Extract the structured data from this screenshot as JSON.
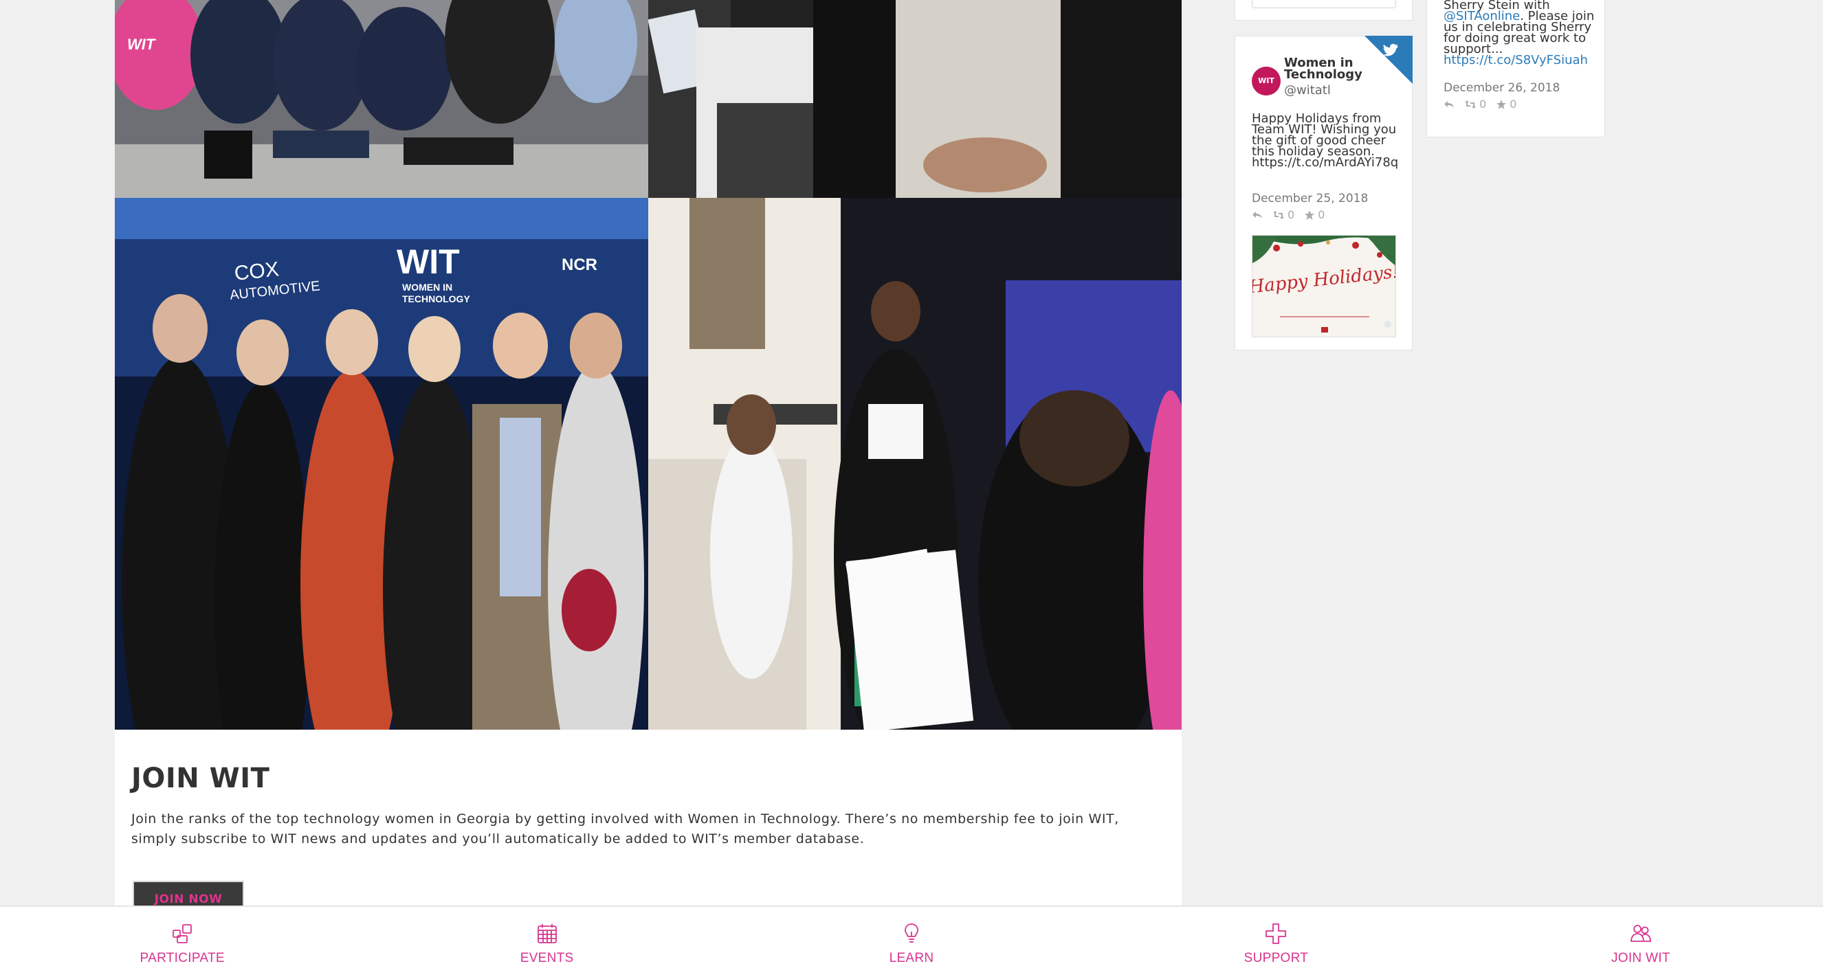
{
  "photos": [
    {
      "alt": "group-seated-photo"
    },
    {
      "alt": "seated-person-photo"
    },
    {
      "alt": "group-at-event-photo",
      "backdrop_texts": [
        "COX AUTOMOTIVE",
        "WIT",
        "WOMEN IN TECHNOLOGY",
        "NCR"
      ]
    },
    {
      "alt": "students-reading-photo"
    }
  ],
  "join": {
    "title": "JOIN WIT",
    "text": "Join the ranks of the top technology women in Georgia by getting involved with Women in Technology. There’s no membership fee to join WIT, simply subscribe to WIT news and updates and you’ll automatically be added to WIT’s member database.",
    "button_label": "JOIN NOW"
  },
  "tweet1": {
    "avatar_text": "WIT",
    "name": "Women in Technology",
    "handle": "@witatl",
    "text": "Happy Holidays from Team WIT! Wishing you the gift of good cheer this holiday season. https://t.co/mArdAYi78q",
    "date": "December 25, 2018",
    "retweets": "0",
    "likes": "0",
    "image_text": "Happy Holidays!"
  },
  "tweet2": {
    "text_prefix": "Sherry Stein with ",
    "mention": "@SITAonline",
    "text_suffix": ". Please join us in celebrating Sherry for doing great work to support...",
    "link": "https://t.co/S8VyFSiuah",
    "date": "December 26, 2018",
    "retweets": "0",
    "likes": "0"
  },
  "nav": {
    "items": [
      {
        "label": "PARTICIPATE",
        "icon": "participate-icon"
      },
      {
        "label": "EVENTS",
        "icon": "calendar-icon"
      },
      {
        "label": "LEARN",
        "icon": "lightbulb-icon"
      },
      {
        "label": "SUPPORT",
        "icon": "plus-icon"
      },
      {
        "label": "JOIN WIT",
        "icon": "people-icon"
      }
    ]
  },
  "colors": {
    "accent": "#d8348e",
    "twitter_blue": "#2b7bb9",
    "button_bg": "#3a3a3a"
  }
}
